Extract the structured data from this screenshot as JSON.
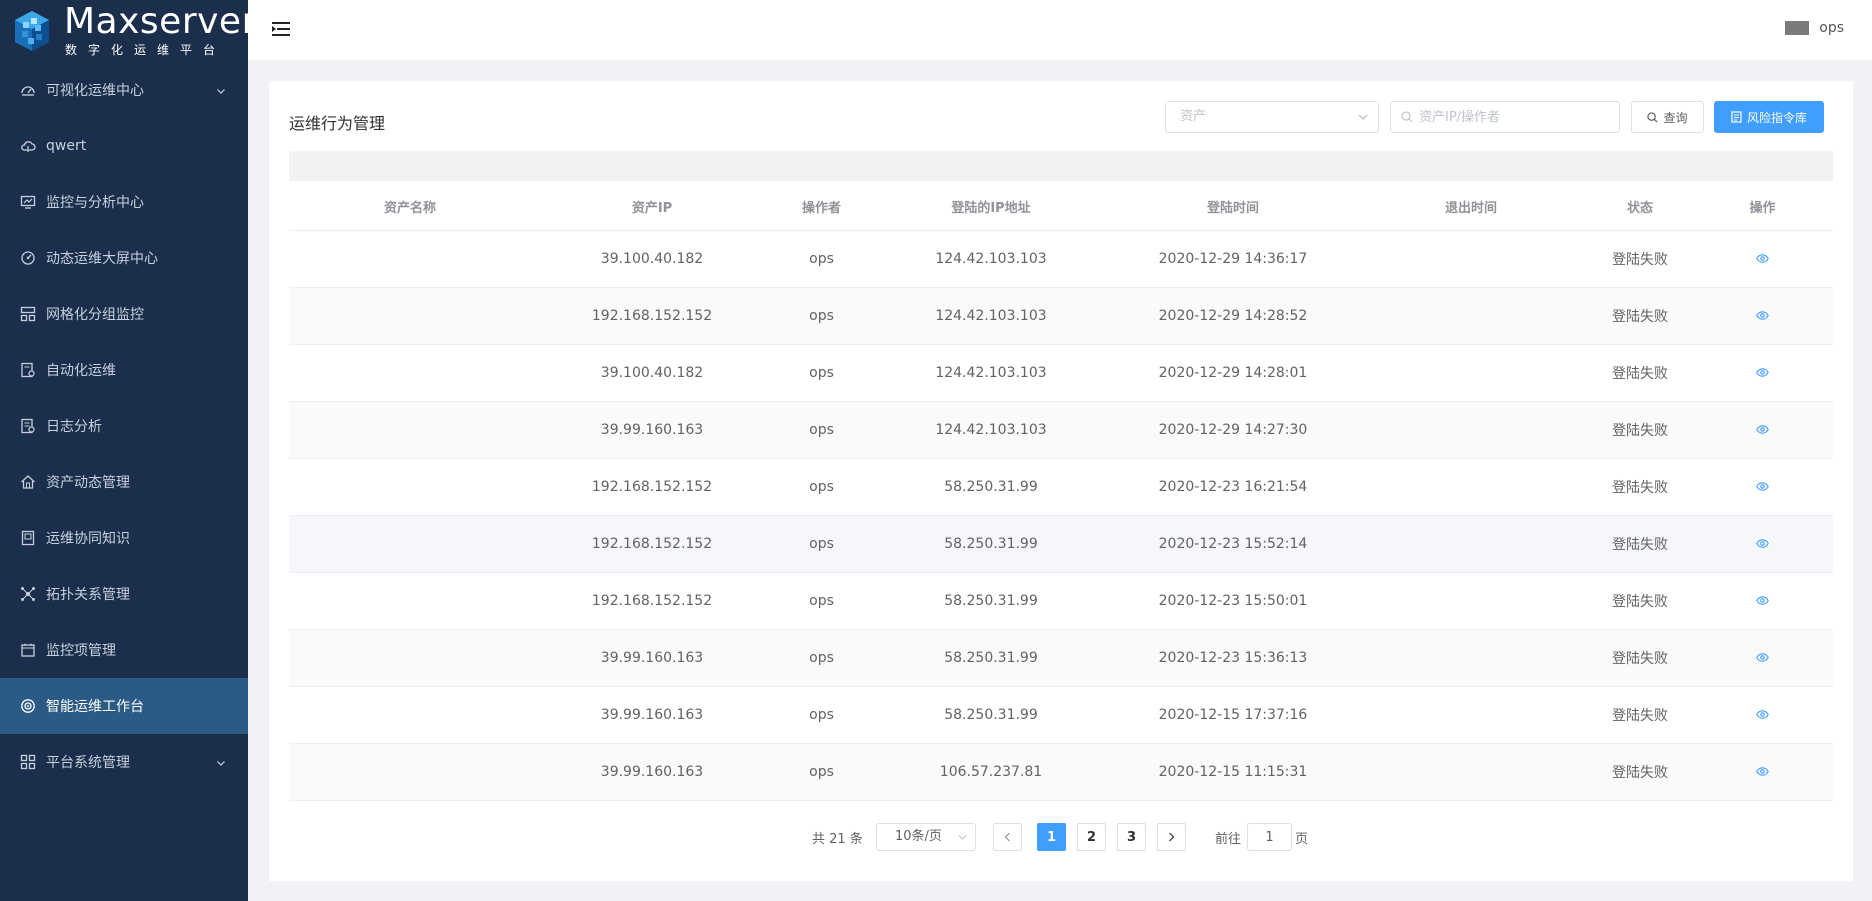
{
  "app": {
    "logo_title": "Maxserver",
    "logo_subtitle": "数字化运维平台",
    "brand_color": "#1b2f4d",
    "accent_color": "#409eff"
  },
  "sidebar": {
    "items": [
      {
        "label": "可视化运维中心",
        "icon": "dashboard-icon",
        "has_submenu": true
      },
      {
        "label": "qwert",
        "icon": "cloud-icon",
        "has_submenu": false
      },
      {
        "label": "监控与分析中心",
        "icon": "monitor-chart-icon",
        "has_submenu": false
      },
      {
        "label": "动态运维大屏中心",
        "icon": "gauge-icon",
        "has_submenu": false
      },
      {
        "label": "网格化分组监控",
        "icon": "grid-icon",
        "has_submenu": false
      },
      {
        "label": "自动化运维",
        "icon": "document-gear-icon",
        "has_submenu": false
      },
      {
        "label": "日志分析",
        "icon": "log-icon",
        "has_submenu": false
      },
      {
        "label": "资产动态管理",
        "icon": "home-icon",
        "has_submenu": false
      },
      {
        "label": "运维协同知识",
        "icon": "book-icon",
        "has_submenu": false
      },
      {
        "label": "拓扑关系管理",
        "icon": "topology-icon",
        "has_submenu": false
      },
      {
        "label": "监控项管理",
        "icon": "calendar-icon",
        "has_submenu": false
      },
      {
        "label": "智能运维工作台",
        "icon": "ai-icon",
        "has_submenu": false,
        "active": true
      },
      {
        "label": "平台系统管理",
        "icon": "apps-icon",
        "has_submenu": true
      }
    ]
  },
  "header": {
    "username": "ops"
  },
  "page": {
    "title": "运维行为管理",
    "asset_select_placeholder": "资产",
    "search_placeholder": "资产IP/操作者",
    "query_button": "查询",
    "risk_button": "风险指令库"
  },
  "table": {
    "columns": [
      "资产名称",
      "资产IP",
      "操作者",
      "登陆的IP地址",
      "登陆时间",
      "退出时间",
      "状态",
      "操作"
    ],
    "rows": [
      {
        "asset_name": "",
        "asset_ip": "39.100.40.182",
        "operator": "ops",
        "login_ip": "124.42.103.103",
        "login_time": "2020-12-29 14:36:17",
        "logout_time": "",
        "status": "登陆失败"
      },
      {
        "asset_name": "",
        "asset_ip": "192.168.152.152",
        "operator": "ops",
        "login_ip": "124.42.103.103",
        "login_time": "2020-12-29 14:28:52",
        "logout_time": "",
        "status": "登陆失败"
      },
      {
        "asset_name": "",
        "asset_ip": "39.100.40.182",
        "operator": "ops",
        "login_ip": "124.42.103.103",
        "login_time": "2020-12-29 14:28:01",
        "logout_time": "",
        "status": "登陆失败"
      },
      {
        "asset_name": "",
        "asset_ip": "39.99.160.163",
        "operator": "ops",
        "login_ip": "124.42.103.103",
        "login_time": "2020-12-29 14:27:30",
        "logout_time": "",
        "status": "登陆失败"
      },
      {
        "asset_name": "",
        "asset_ip": "192.168.152.152",
        "operator": "ops",
        "login_ip": "58.250.31.99",
        "login_time": "2020-12-23 16:21:54",
        "logout_time": "",
        "status": "登陆失败"
      },
      {
        "asset_name": "",
        "asset_ip": "192.168.152.152",
        "operator": "ops",
        "login_ip": "58.250.31.99",
        "login_time": "2020-12-23 15:52:14",
        "logout_time": "",
        "status": "登陆失败"
      },
      {
        "asset_name": "",
        "asset_ip": "192.168.152.152",
        "operator": "ops",
        "login_ip": "58.250.31.99",
        "login_time": "2020-12-23 15:50:01",
        "logout_time": "",
        "status": "登陆失败"
      },
      {
        "asset_name": "",
        "asset_ip": "39.99.160.163",
        "operator": "ops",
        "login_ip": "58.250.31.99",
        "login_time": "2020-12-23 15:36:13",
        "logout_time": "",
        "status": "登陆失败"
      },
      {
        "asset_name": "",
        "asset_ip": "39.99.160.163",
        "operator": "ops",
        "login_ip": "58.250.31.99",
        "login_time": "2020-12-15 17:37:16",
        "logout_time": "",
        "status": "登陆失败"
      },
      {
        "asset_name": "",
        "asset_ip": "39.99.160.163",
        "operator": "ops",
        "login_ip": "106.57.237.81",
        "login_time": "2020-12-15 11:15:31",
        "logout_time": "",
        "status": "登陆失败"
      }
    ]
  },
  "pagination": {
    "total_text": "共 21 条",
    "page_size": "10条/页",
    "pages": [
      "1",
      "2",
      "3"
    ],
    "current_page": "1",
    "goto_prefix": "前往",
    "goto_value": "1",
    "goto_suffix": "页"
  }
}
